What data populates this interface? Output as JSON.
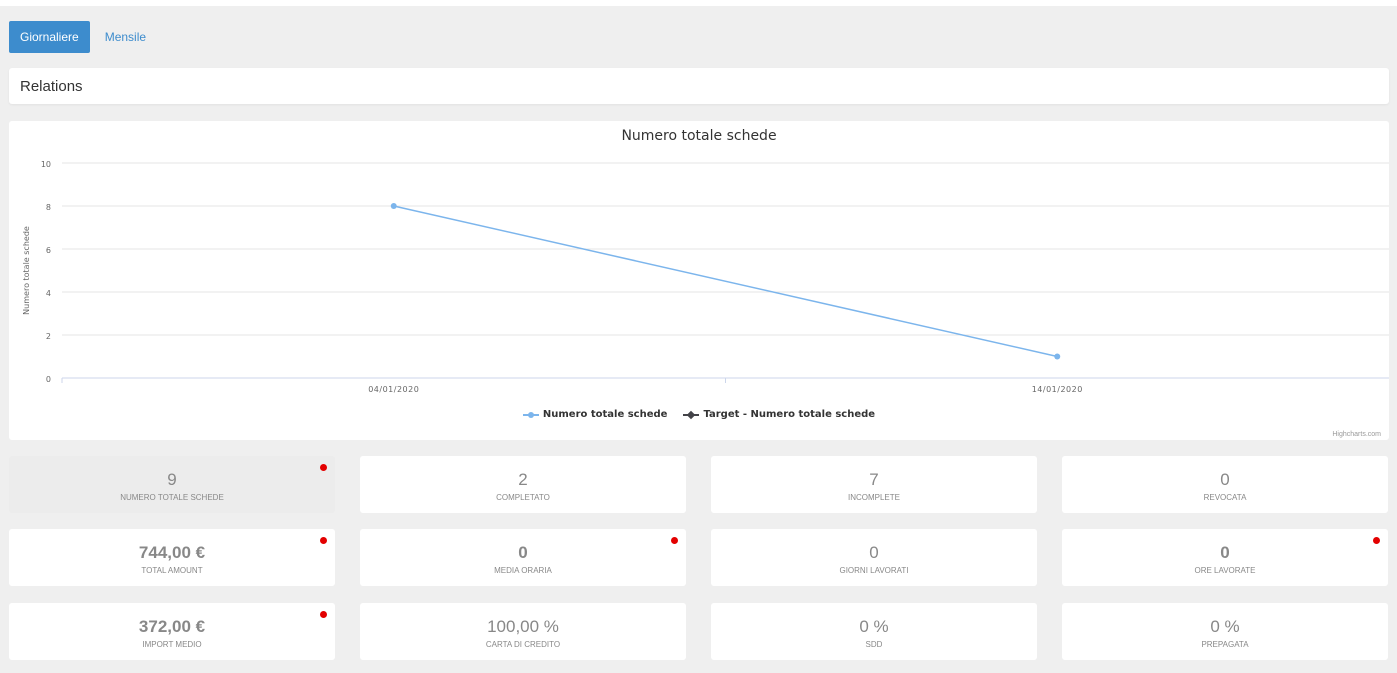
{
  "tabs": {
    "active": "Giornaliere",
    "other": "Mensile"
  },
  "section_title": "Relations",
  "chart_data": {
    "type": "line",
    "title": "Numero totale schede",
    "ylabel": "Numero totale schede",
    "xlabel": "",
    "categories": [
      "04/01/2020",
      "14/01/2020"
    ],
    "yticks": [
      "0",
      "2",
      "4",
      "6",
      "8",
      "10"
    ],
    "ylim": [
      0,
      10
    ],
    "grid": true,
    "legend_position": "bottom",
    "series": [
      {
        "name": "Numero totale schede",
        "values": [
          8,
          1
        ],
        "color": "#7cb5ec"
      },
      {
        "name": "Target - Numero totale schede",
        "values": [
          null,
          null
        ],
        "color": "#434348"
      }
    ],
    "credits": "Highcharts.com"
  },
  "kpis": [
    {
      "value": "9",
      "label": "NUMERO TOTALE SCHEDE",
      "alert": true,
      "bold": false,
      "highlight": true
    },
    {
      "value": "2",
      "label": "COMPLETATO",
      "alert": false,
      "bold": false,
      "highlight": false
    },
    {
      "value": "7",
      "label": "INCOMPLETE",
      "alert": false,
      "bold": false,
      "highlight": false
    },
    {
      "value": "0",
      "label": "REVOCATA",
      "alert": false,
      "bold": false,
      "highlight": false
    },
    {
      "value": "744,00 €",
      "label": "TOTAL AMOUNT",
      "alert": true,
      "bold": true,
      "highlight": false
    },
    {
      "value": "0",
      "label": "MEDIA ORARIA",
      "alert": true,
      "bold": true,
      "highlight": false
    },
    {
      "value": "0",
      "label": "GIORNI LAVORATI",
      "alert": false,
      "bold": false,
      "highlight": false
    },
    {
      "value": "0",
      "label": "ORE LAVORATE",
      "alert": true,
      "bold": true,
      "highlight": false
    },
    {
      "value": "372,00 €",
      "label": "IMPORT MEDIO",
      "alert": true,
      "bold": true,
      "highlight": false
    },
    {
      "value": "100,00 %",
      "label": "CARTA DI CREDITO",
      "alert": false,
      "bold": false,
      "highlight": false
    },
    {
      "value": "0 %",
      "label": "SDD",
      "alert": false,
      "bold": false,
      "highlight": false
    },
    {
      "value": "0 %",
      "label": "PREPAGATA",
      "alert": false,
      "bold": false,
      "highlight": false
    }
  ],
  "colors": {
    "accent": "#3d8ccd",
    "alert": "#e30000"
  }
}
